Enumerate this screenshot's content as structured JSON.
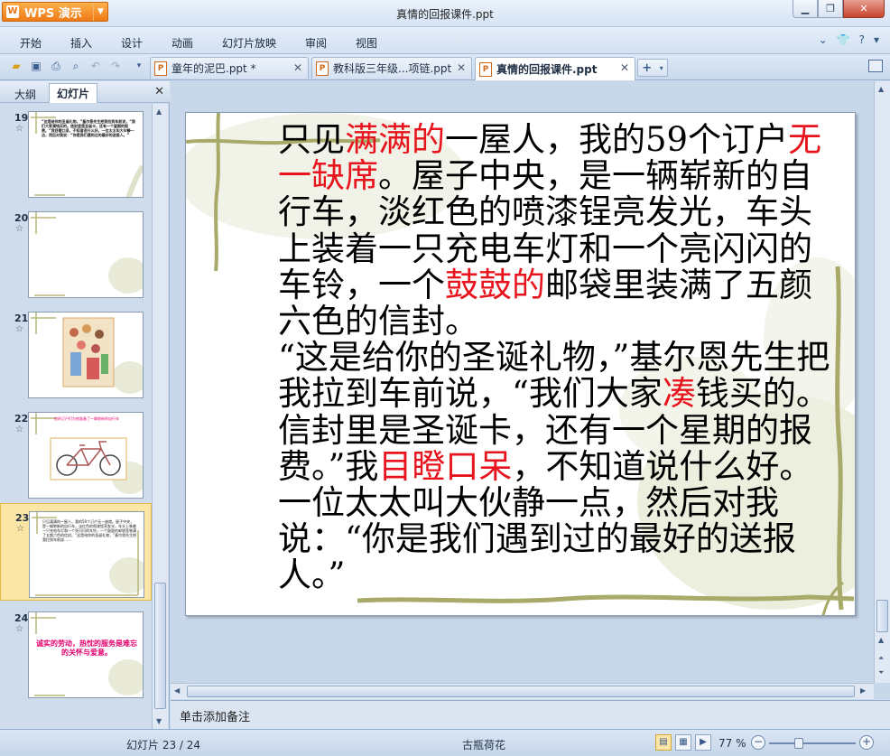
{
  "app": {
    "brand": "WPS 演示",
    "title": "真情的回报课件.ppt"
  },
  "menu": [
    "开始",
    "插入",
    "设计",
    "动画",
    "幻灯片放映",
    "审阅",
    "视图"
  ],
  "tabs": [
    {
      "label": "童年的泥巴.ppt *",
      "active": false
    },
    {
      "label": "教科版三年级...项链.ppt",
      "active": false
    },
    {
      "label": "真情的回报课件.ppt",
      "active": true
    }
  ],
  "left_panel": {
    "tab_outline": "大纲",
    "tab_slides": "幻灯片",
    "slides": [
      {
        "number": "19",
        "text": "“这是给你的圣诞礼物，”基尔恩先生把我拉到车前说，“我们大家凑钱买的。信封里是圣诞卡，还有一个星期的报费。”我目瞪口呆，不知道说什么好。一位太太叫大伙静一点，然后对我说：“你是我们遇到过的最好的送报人。”"
      },
      {
        "number": "20",
        "text": ""
      },
      {
        "number": "21",
        "text": ""
      },
      {
        "number": "22",
        "text": "他的订户们为他准备了一辆崭新的自行车"
      },
      {
        "number": "23",
        "text": "只见满满的一屋人，我的59个订户无一缺席。屋子中央，是一辆崭新的自行车，淡红色的喷漆锃亮发光，车头上装着一只充电车灯和一个亮闪闪的车铃，一个鼓鼓的邮袋里装满了五颜六色的信封。“这是给你的圣诞礼物，”基尔恩先生把我拉到车前说……"
      },
      {
        "number": "24",
        "text": "诚实的劳动，热忱的服务是难忘的关怀与爱意。"
      }
    ]
  },
  "slide": {
    "p1_a": "只见",
    "p1_b": "满满的",
    "p1_c": "一屋人，我的59个订户",
    "p1_d": "无一缺席",
    "p1_e": "。屋子中央，是一辆崭新的自行车，淡红色的喷漆锃亮发光，车头上装着一只充电车灯和一个亮闪闪的车铃，一个",
    "p1_f": "鼓鼓的",
    "p1_g": "邮袋里装满了五颜六色的信封。",
    "p2_a": "“这是给你的圣诞礼物，”基尔恩先生把我拉到车前说，“我们大家",
    "p2_b": "凑",
    "p2_c": "钱买的。信封里是圣诞卡，还有一个星期的报费。”我",
    "p2_d": "目瞪口呆",
    "p2_e": "，不知道说什么好。一位太太叫大伙静一点，然后对我说：“你是我们遇到过的最好的送报人。”"
  },
  "notes_placeholder": "单击添加备注",
  "status": {
    "slide_counter": "幻灯片 23 / 24",
    "theme": "古瓶荷花",
    "zoom": "77 %"
  },
  "colors": {
    "highlight_red": "#e8141d",
    "selected_thumb": "#fbe6a6",
    "wps_orange": "#ee7a16"
  }
}
